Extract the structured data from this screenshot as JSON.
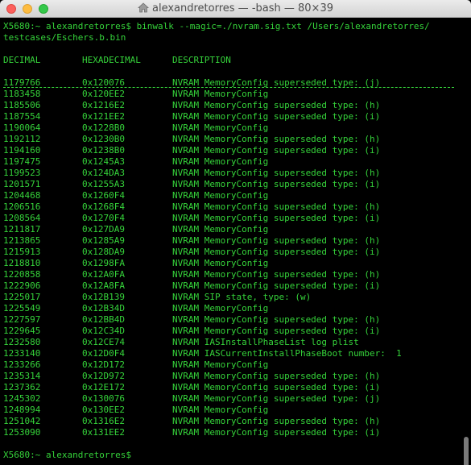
{
  "window": {
    "title": "alexandretorres — -bash — 80×39"
  },
  "command": {
    "line1": "X5680:~ alexandretorres$ binwalk --magic=./nvram.sig.txt /Users/alexandretorres/",
    "line2": "testcases/Eschers.b.bin"
  },
  "headers": {
    "decimal": "DECIMAL",
    "hexadecimal": "HEXADECIMAL",
    "description": "DESCRIPTION"
  },
  "rows": [
    {
      "dec": "1179766",
      "hex": "0x120076",
      "desc": "NVRAM MemoryConfig superseded type: (j)"
    },
    {
      "dec": "1183458",
      "hex": "0x120EE2",
      "desc": "NVRAM MemoryConfig"
    },
    {
      "dec": "1185506",
      "hex": "0x1216E2",
      "desc": "NVRAM MemoryConfig superseded type: (h)"
    },
    {
      "dec": "1187554",
      "hex": "0x121EE2",
      "desc": "NVRAM MemoryConfig superseded type: (i)"
    },
    {
      "dec": "1190064",
      "hex": "0x1228B0",
      "desc": "NVRAM MemoryConfig"
    },
    {
      "dec": "1192112",
      "hex": "0x1230B0",
      "desc": "NVRAM MemoryConfig superseded type: (h)"
    },
    {
      "dec": "1194160",
      "hex": "0x1238B0",
      "desc": "NVRAM MemoryConfig superseded type: (i)"
    },
    {
      "dec": "1197475",
      "hex": "0x1245A3",
      "desc": "NVRAM MemoryConfig"
    },
    {
      "dec": "1199523",
      "hex": "0x124DA3",
      "desc": "NVRAM MemoryConfig superseded type: (h)"
    },
    {
      "dec": "1201571",
      "hex": "0x1255A3",
      "desc": "NVRAM MemoryConfig superseded type: (i)"
    },
    {
      "dec": "1204468",
      "hex": "0x1260F4",
      "desc": "NVRAM MemoryConfig"
    },
    {
      "dec": "1206516",
      "hex": "0x1268F4",
      "desc": "NVRAM MemoryConfig superseded type: (h)"
    },
    {
      "dec": "1208564",
      "hex": "0x1270F4",
      "desc": "NVRAM MemoryConfig superseded type: (i)"
    },
    {
      "dec": "1211817",
      "hex": "0x127DA9",
      "desc": "NVRAM MemoryConfig"
    },
    {
      "dec": "1213865",
      "hex": "0x1285A9",
      "desc": "NVRAM MemoryConfig superseded type: (h)"
    },
    {
      "dec": "1215913",
      "hex": "0x128DA9",
      "desc": "NVRAM MemoryConfig superseded type: (i)"
    },
    {
      "dec": "1218810",
      "hex": "0x1298FA",
      "desc": "NVRAM MemoryConfig"
    },
    {
      "dec": "1220858",
      "hex": "0x12A0FA",
      "desc": "NVRAM MemoryConfig superseded type: (h)"
    },
    {
      "dec": "1222906",
      "hex": "0x12A8FA",
      "desc": "NVRAM MemoryConfig superseded type: (i)"
    },
    {
      "dec": "1225017",
      "hex": "0x12B139",
      "desc": "NVRAM SIP state, type: (w)"
    },
    {
      "dec": "1225549",
      "hex": "0x12B34D",
      "desc": "NVRAM MemoryConfig"
    },
    {
      "dec": "1227597",
      "hex": "0x12BB4D",
      "desc": "NVRAM MemoryConfig superseded type: (h)"
    },
    {
      "dec": "1229645",
      "hex": "0x12C34D",
      "desc": "NVRAM MemoryConfig superseded type: (i)"
    },
    {
      "dec": "1232580",
      "hex": "0x12CE74",
      "desc": "NVRAM IASInstallPhaseList log plist"
    },
    {
      "dec": "1233140",
      "hex": "0x12D0F4",
      "desc": "NVRAM IASCurrentInstallPhaseBoot number:  1"
    },
    {
      "dec": "1233266",
      "hex": "0x12D172",
      "desc": "NVRAM MemoryConfig"
    },
    {
      "dec": "1235314",
      "hex": "0x12D972",
      "desc": "NVRAM MemoryConfig superseded type: (h)"
    },
    {
      "dec": "1237362",
      "hex": "0x12E172",
      "desc": "NVRAM MemoryConfig superseded type: (i)"
    },
    {
      "dec": "1245302",
      "hex": "0x130076",
      "desc": "NVRAM MemoryConfig superseded type: (j)"
    },
    {
      "dec": "1248994",
      "hex": "0x130EE2",
      "desc": "NVRAM MemoryConfig"
    },
    {
      "dec": "1251042",
      "hex": "0x1316E2",
      "desc": "NVRAM MemoryConfig superseded type: (h)"
    },
    {
      "dec": "1253090",
      "hex": "0x131EE2",
      "desc": "NVRAM MemoryConfig superseded type: (i)"
    }
  ],
  "prompt": "X5680:~ alexandretorres$",
  "colors": {
    "terminal_text": "#35d33a",
    "terminal_bg": "#000000"
  },
  "icons": {
    "title_icon": "home-icon"
  }
}
